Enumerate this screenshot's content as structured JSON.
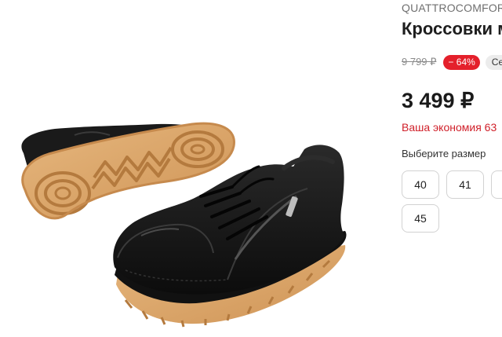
{
  "product": {
    "brand": "QUATTROCOMFORT",
    "title": "Кроссовки м",
    "old_price": "9 799 ₽",
    "discount": "− 64%",
    "promo_label": "Сей",
    "price": "3 499 ₽",
    "savings": "Ваша экономия 63",
    "image_alt": "Black leather sneakers with gum rubber sole"
  },
  "size_selector": {
    "label": "Выберите размер",
    "sizes": [
      "40",
      "41",
      "",
      "45"
    ]
  },
  "colors": {
    "accent_red": "#e4202b",
    "savings_text": "#d0202a",
    "leather_black": "#141414",
    "sole_gum": "#d9a568"
  }
}
